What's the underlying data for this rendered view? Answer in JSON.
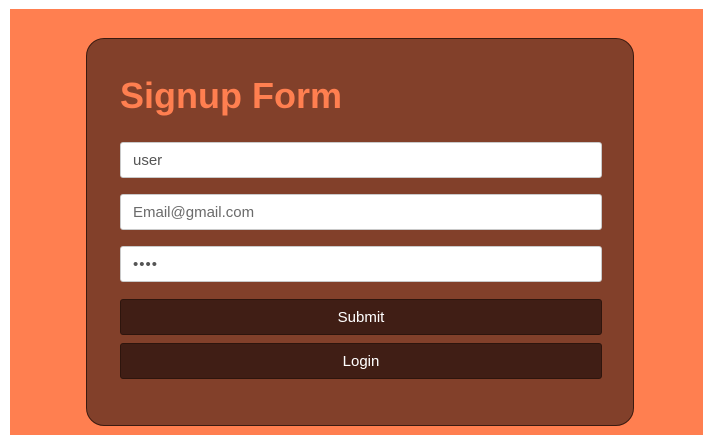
{
  "form": {
    "title": "Signup Form",
    "username": {
      "value": "user",
      "placeholder": ""
    },
    "email": {
      "value": "",
      "placeholder": "Email@gmail.com"
    },
    "password": {
      "value": "abcd",
      "placeholder": ""
    },
    "submit_label": "Submit",
    "login_label": "Login"
  },
  "colors": {
    "page_background": "#ff7f50",
    "card_background": "#82402a",
    "title": "#ff7f50",
    "button_background": "#401e15",
    "button_text": "#ffffff"
  }
}
